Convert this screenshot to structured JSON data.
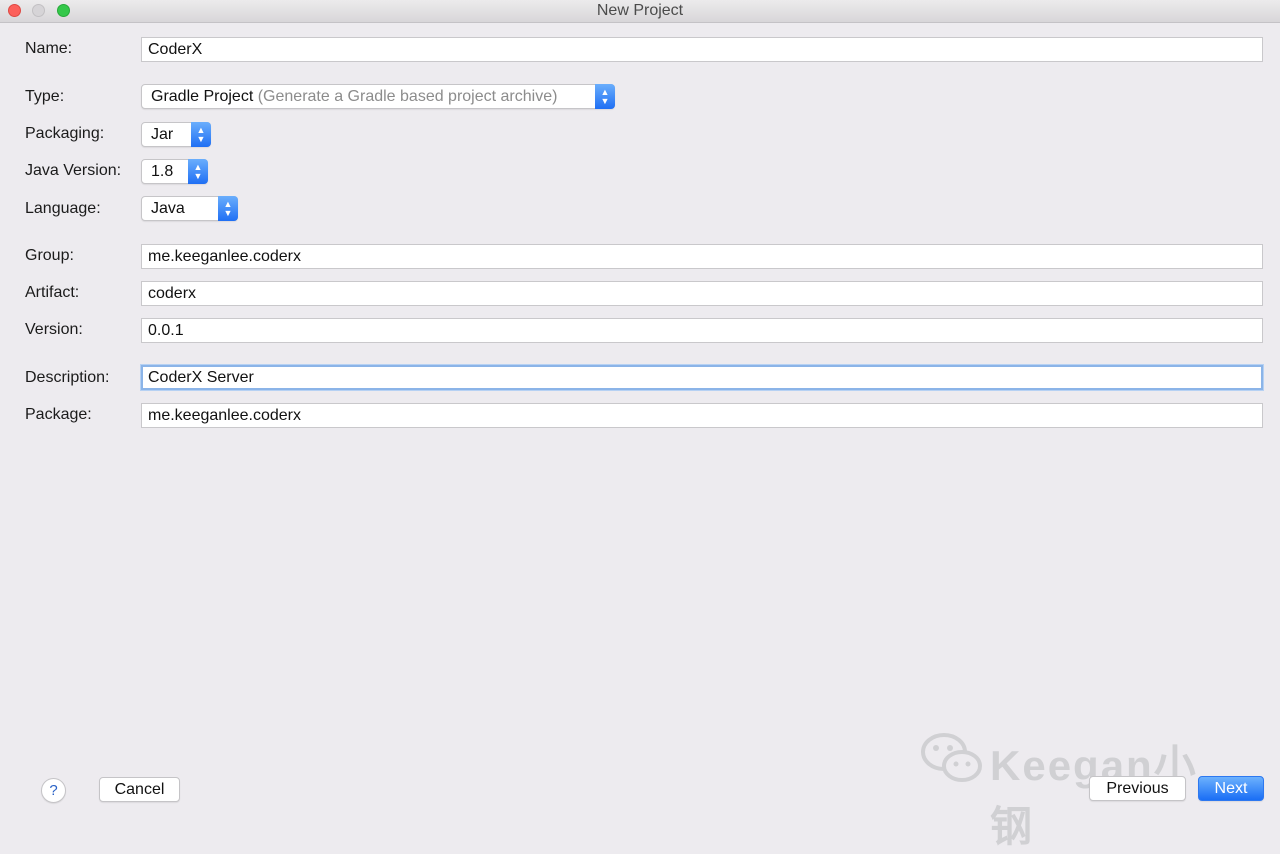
{
  "window": {
    "title": "New Project"
  },
  "form": {
    "name": {
      "label": "Name:",
      "value": "CoderX"
    },
    "type": {
      "label": "Type:",
      "value": "Gradle Project",
      "hint": "(Generate a Gradle based project archive)"
    },
    "packaging": {
      "label": "Packaging:",
      "value": "Jar"
    },
    "java_version": {
      "label": "Java Version:",
      "value": "1.8"
    },
    "language": {
      "label": "Language:",
      "value": "Java"
    },
    "group": {
      "label": "Group:",
      "value": "me.keeganlee.coderx"
    },
    "artifact": {
      "label": "Artifact:",
      "value": "coderx"
    },
    "version": {
      "label": "Version:",
      "value": "0.0.1"
    },
    "description": {
      "label": "Description:",
      "value": "CoderX Server"
    },
    "package": {
      "label": "Package:",
      "value": "me.keeganlee.coderx"
    }
  },
  "footer": {
    "help_label": "?",
    "cancel_label": "Cancel",
    "previous_label": "Previous",
    "next_label": "Next"
  },
  "watermark": {
    "text": "Keegan小钢",
    "icon": "wechat-icon"
  },
  "colors": {
    "accent": "#1a6ef5",
    "focus_ring": "#8bb4e8",
    "background": "#edebef"
  }
}
